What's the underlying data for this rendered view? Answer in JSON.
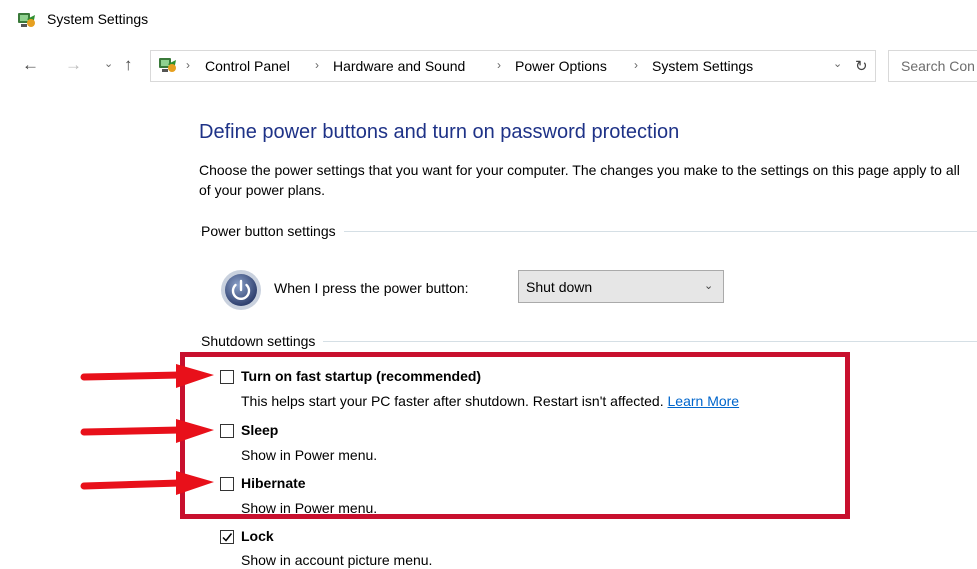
{
  "window": {
    "title": "System Settings"
  },
  "nav": {
    "back": "←",
    "forward": "→",
    "recent": "⌄",
    "up": "↑",
    "dropdown": "⌄",
    "refresh": "↻",
    "separator": "›",
    "breadcrumbs": [
      "Control Panel",
      "Hardware and Sound",
      "Power Options",
      "System Settings"
    ]
  },
  "search": {
    "placeholder": "Search Con"
  },
  "page": {
    "heading": "Define power buttons and turn on password protection",
    "description": "Choose the power settings that you want for your computer. The changes you make to the settings on this page apply to all of your power plans."
  },
  "power_button": {
    "section_title": "Power button settings",
    "label": "When I press the power button:",
    "selected": "Shut down"
  },
  "shutdown": {
    "section_title": "Shutdown settings",
    "items": [
      {
        "label": "Turn on fast startup (recommended)",
        "desc": "This helps start your PC faster after shutdown. Restart isn't affected. ",
        "link": "Learn More",
        "checked": false
      },
      {
        "label": "Sleep",
        "desc": "Show in Power menu.",
        "checked": false
      },
      {
        "label": "Hibernate",
        "desc": "Show in Power menu.",
        "checked": false
      },
      {
        "label": "Lock",
        "desc": "Show in account picture menu.",
        "checked": true
      }
    ]
  },
  "colors": {
    "heading": "#1e3287",
    "highlight_box": "#c8102e",
    "arrows": "#e8101a",
    "link": "#0066cc"
  }
}
